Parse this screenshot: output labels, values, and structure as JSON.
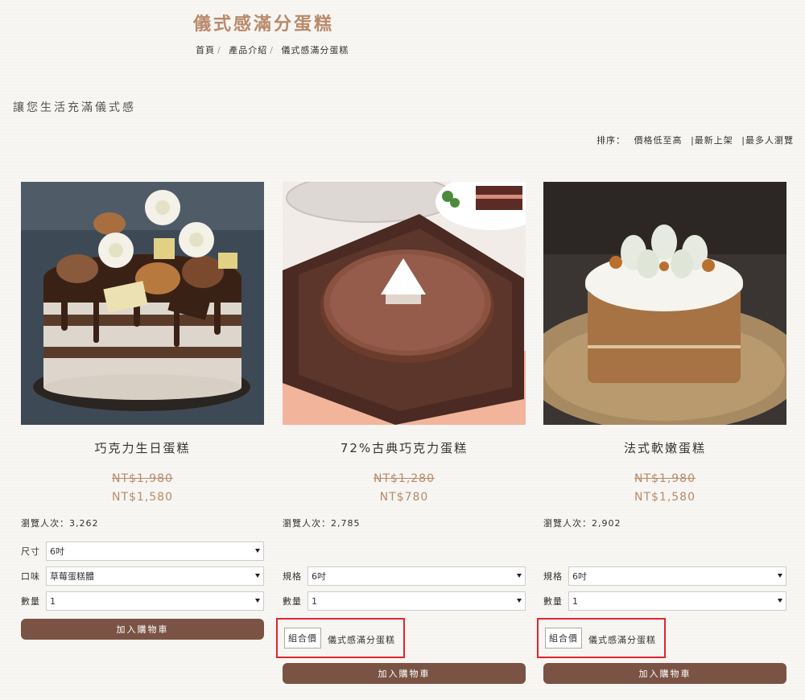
{
  "page": {
    "title": "儀式感滿分蛋糕",
    "tagline": "讓您生活充滿儀式感"
  },
  "breadcrumb": [
    "首頁",
    "產品介紹",
    "儀式感滿分蛋糕"
  ],
  "sort": {
    "label": "排序：",
    "options": [
      "價格低至高",
      "|最新上架",
      "|最多人瀏覽"
    ]
  },
  "products": [
    {
      "name": "巧克力生日蛋糕",
      "old_price": "NT$1,980",
      "price": "NT$1,580",
      "views": "瀏覽人次：3,262",
      "options": [
        {
          "label": "尺寸",
          "value": "6吋"
        },
        {
          "label": "口味",
          "value": "草莓蛋糕體"
        },
        {
          "label": "數量",
          "value": "1"
        }
      ],
      "cart_label": "加入購物車"
    },
    {
      "name": "72%古典巧克力蛋糕",
      "old_price": "NT$1,280",
      "price": "NT$780",
      "views": "瀏覽人次：2,785",
      "options": [
        {
          "label": "規格",
          "value": "6吋"
        },
        {
          "label": "數量",
          "value": "1"
        }
      ],
      "combo": {
        "tag": "組合價",
        "text": "儀式感滿分蛋糕"
      },
      "cart_label": "加入購物車"
    },
    {
      "name": "法式軟嫩蛋糕",
      "old_price": "NT$1,980",
      "price": "NT$1,580",
      "views": "瀏覽人次：2,902",
      "options": [
        {
          "label": "規格",
          "value": "6吋"
        },
        {
          "label": "數量",
          "value": "1"
        }
      ],
      "combo": {
        "tag": "組合價",
        "text": "儀式感滿分蛋糕"
      },
      "cart_label": "加入購物車"
    }
  ]
}
